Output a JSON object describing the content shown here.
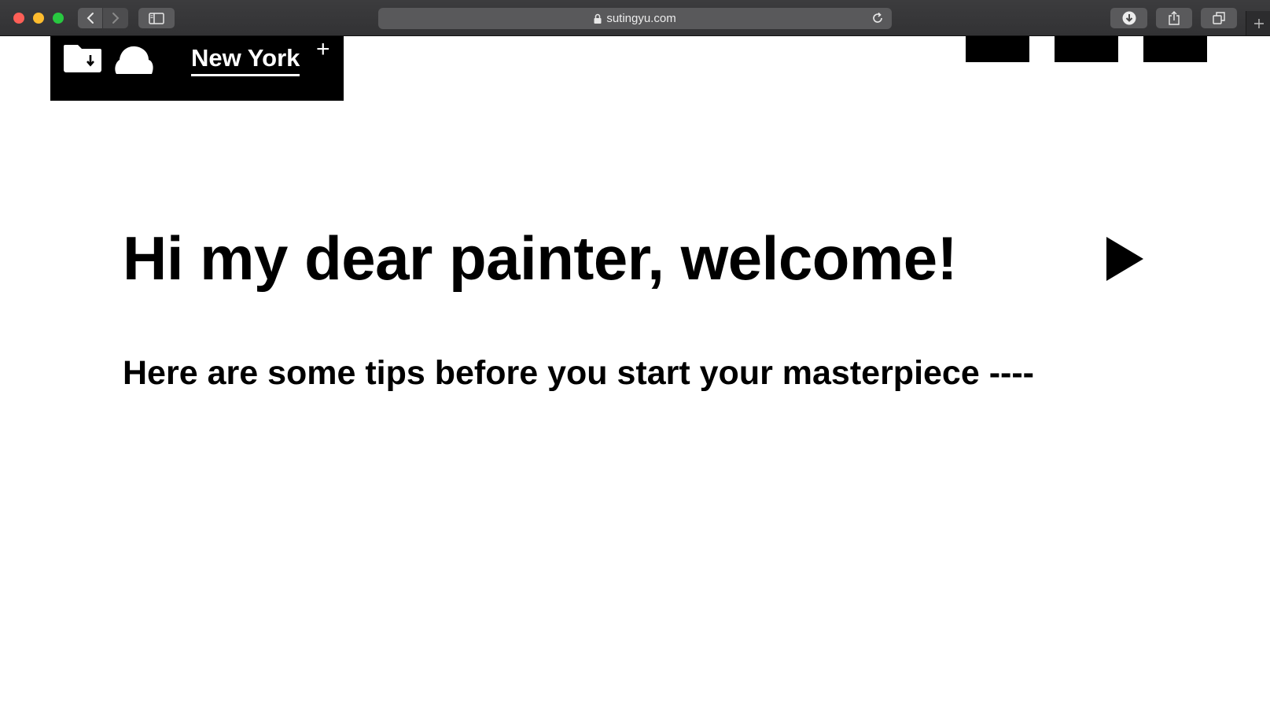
{
  "browser": {
    "url": "sutingyu.com",
    "icons": {
      "back": "chevron-left-icon",
      "forward": "chevron-right-icon",
      "sidebar": "sidebar-icon",
      "lock": "lock-icon",
      "reload": "reload-icon",
      "downloads": "download-icon",
      "share": "share-icon",
      "tabs": "tabs-icon",
      "new_tab": "plus-icon"
    }
  },
  "header": {
    "city": "New York",
    "add_symbol": "+",
    "icons": {
      "folder": "folder-download-icon",
      "cloud": "cloud-icon"
    },
    "colors": {
      "bar": "#000000",
      "text": "#ffffff"
    }
  },
  "main": {
    "headline": "Hi my dear painter, welcome!",
    "subheadline": "Here are some tips before you start your masterpiece ----",
    "next_icon": "play-icon"
  }
}
